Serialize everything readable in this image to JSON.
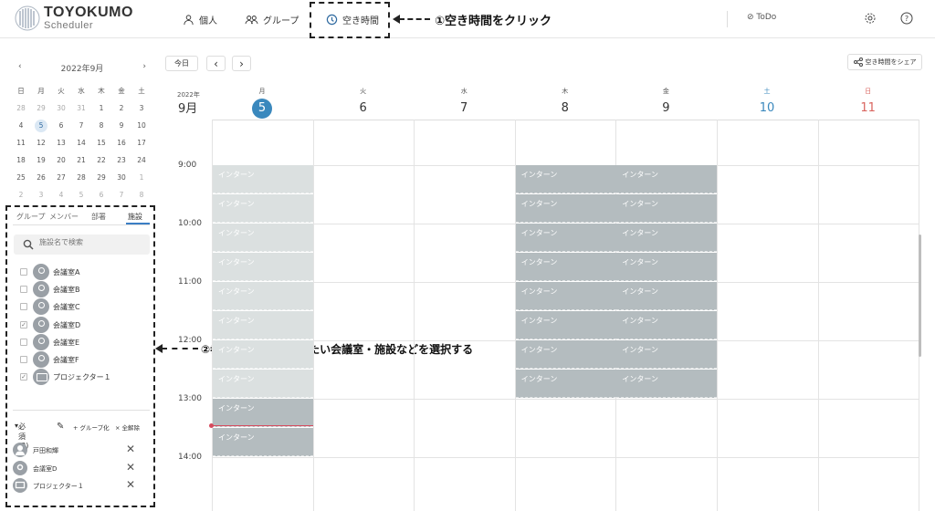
{
  "header": {
    "brand": "TOYOKUMO",
    "brand_sub": "Scheduler",
    "nav": {
      "personal": "個人",
      "group": "グループ",
      "free_time": "空き時間"
    },
    "todo": "ToDo"
  },
  "annotations": {
    "step1": "①空き時間をクリック",
    "step2": "②参加する人・使用したい会議室・施設などを選択する"
  },
  "sidebar": {
    "month_label": "2022年9月",
    "prev": "‹",
    "next": "›",
    "weekdays": [
      "日",
      "月",
      "火",
      "水",
      "木",
      "金",
      "土"
    ],
    "weeks": [
      [
        "28",
        "29",
        "30",
        "31",
        "1",
        "2",
        "3"
      ],
      [
        "4",
        "5",
        "6",
        "7",
        "8",
        "9",
        "10"
      ],
      [
        "11",
        "12",
        "13",
        "14",
        "15",
        "16",
        "17"
      ],
      [
        "18",
        "19",
        "20",
        "21",
        "22",
        "23",
        "24"
      ],
      [
        "25",
        "26",
        "27",
        "28",
        "29",
        "30",
        "1"
      ],
      [
        "2",
        "3",
        "4",
        "5",
        "6",
        "7",
        "8"
      ]
    ],
    "tabs": {
      "group": "グループ",
      "member": "メンバー",
      "dept": "部署",
      "facility": "施設"
    },
    "search_placeholder": "施設名で検索",
    "facilities": [
      {
        "label": "会議室A",
        "checked": false,
        "icon": "pin"
      },
      {
        "label": "会議室B",
        "checked": false,
        "icon": "pin"
      },
      {
        "label": "会議室C",
        "checked": false,
        "icon": "pin"
      },
      {
        "label": "会議室D",
        "checked": true,
        "icon": "pin"
      },
      {
        "label": "会議室E",
        "checked": false,
        "icon": "pin"
      },
      {
        "label": "会議室F",
        "checked": false,
        "icon": "pin"
      },
      {
        "label": "プロジェクター１",
        "checked": true,
        "icon": "screen"
      }
    ],
    "required_label": "必須(3)",
    "group_link": "+ グループ化",
    "clear_link": "× 全解除",
    "required": [
      {
        "label": "戸田和輝",
        "icon": "person"
      },
      {
        "label": "会議室D",
        "icon": "pin"
      },
      {
        "label": "プロジェクター１",
        "icon": "screen"
      }
    ]
  },
  "toolbar": {
    "today": "今日",
    "prev": "‹",
    "next": "›",
    "share": "空き時間をシェア"
  },
  "calendar": {
    "year": "2022年",
    "month": "9月",
    "days": [
      {
        "w": "月",
        "n": "5",
        "color": "#333",
        "today": true
      },
      {
        "w": "火",
        "n": "6",
        "color": "#333"
      },
      {
        "w": "水",
        "n": "7",
        "color": "#333"
      },
      {
        "w": "木",
        "n": "8",
        "color": "#333"
      },
      {
        "w": "金",
        "n": "9",
        "color": "#333"
      },
      {
        "w": "土",
        "n": "10",
        "color": "#3a88bd"
      },
      {
        "w": "日",
        "n": "11",
        "color": "#d9655f"
      }
    ],
    "times": [
      "9:00",
      "10:00",
      "11:00",
      "12:00",
      "13:00",
      "14:00"
    ],
    "event_label": "インターン"
  }
}
